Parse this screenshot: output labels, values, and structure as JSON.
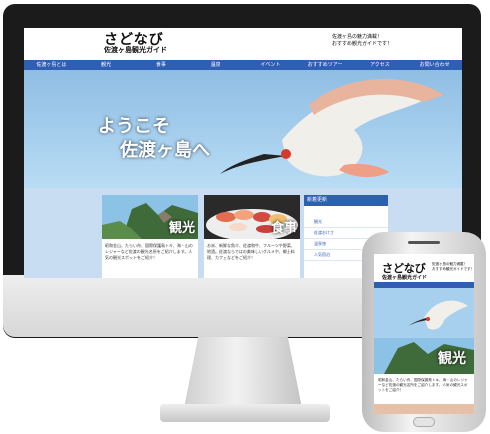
{
  "site": {
    "logo_main": "さどなび",
    "logo_sub": "佐渡ヶ島観光ガイド",
    "tagline": "佐渡ヶ島の魅力満載！\nおすすめ観光ガイドです！",
    "nav": [
      "佐渡ヶ島とは",
      "観光",
      "食事",
      "温泉",
      "イベント",
      "おすすめツアー",
      "アクセス",
      "お問い合わせ"
    ],
    "hero_line1": "ようこそ",
    "hero_line2": "佐渡ヶ島へ",
    "cards": [
      {
        "label": "観光",
        "text": "昭和金山、たらい舟、国際保護鳥トキ、海・山のレジャーなど佐渡の観光名所をご紹介します。人気の観光スポットをご紹介！"
      },
      {
        "label": "食事",
        "text": "お米、新鮮な魚介、佐渡和牛、フルーツや野菜、地酒。佐渡ならではの美味しいグルメや、郷土料理、カフェなどをご紹介！"
      }
    ],
    "sidebar_title": "新着更新",
    "sidebar_items": [
      "観光",
      "佐渡おけさ",
      "温泉旅",
      "人気宿泊"
    ]
  },
  "phone": {
    "logo_main": "さどなび",
    "logo_sub": "佐渡ヶ島観光ガイド",
    "tagline": "佐渡ヶ島の魅力満載！\nおすすめ観光ガイドです！",
    "card_label": "観光",
    "card_text": "昭和金山、たらい舟、国際保護鳥トキ、海・山のレジャーなど佐渡の観光名所をご紹介します。人気の観光スポットをご紹介！"
  }
}
